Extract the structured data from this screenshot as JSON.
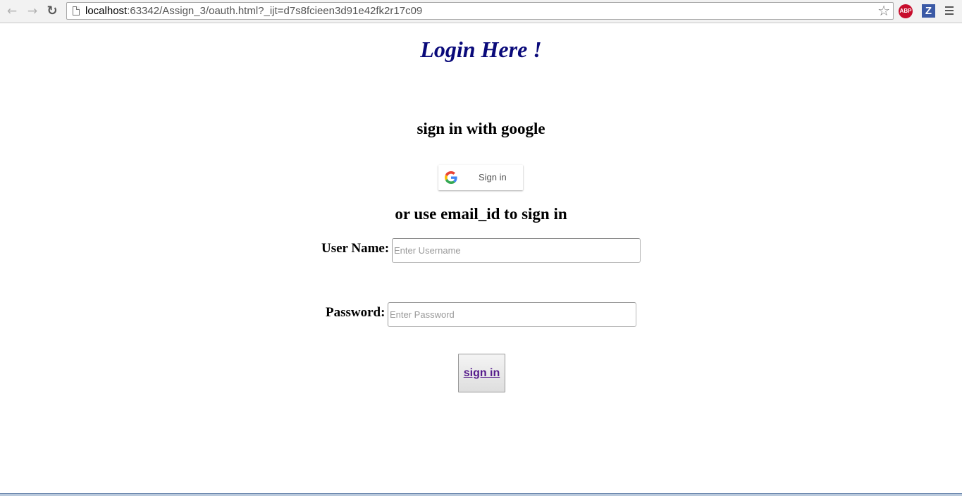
{
  "browser": {
    "url_host": "localhost",
    "url_rest": ":63342/Assign_3/oauth.html?_ijt=d7s8fcieen3d91e42fk2r17c09",
    "abp_label": "ABP",
    "z_label": "Z"
  },
  "page": {
    "title": "Login Here !",
    "google_heading": "sign in with google",
    "google_button_label": "Sign in",
    "email_heading": "or use email_id to sign in",
    "username_label": "User Name:",
    "username_placeholder": "Enter Username",
    "password_label": "Password:",
    "password_placeholder": "Enter Password",
    "submit_label": "sign in"
  },
  "colors": {
    "title": "#0a0a7a",
    "link_visited": "#551a8b",
    "google_blue": "#4285F4",
    "google_red": "#EA4335",
    "google_yellow": "#FBBC05",
    "google_green": "#34A853"
  }
}
